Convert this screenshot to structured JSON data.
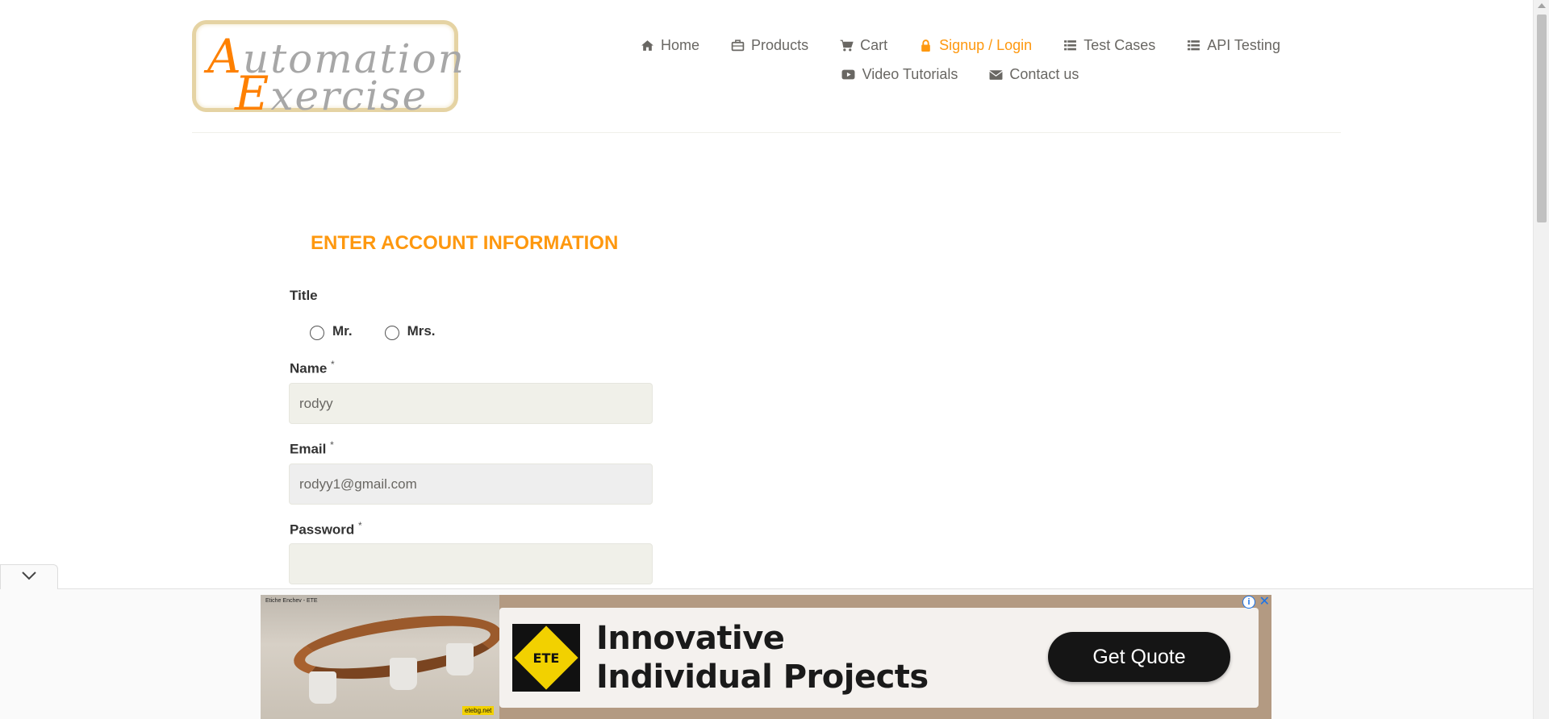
{
  "logo": {
    "line1_cap": "A",
    "line1_rest": "utomation",
    "line2_cap": "E",
    "line2_rest": "xercise"
  },
  "nav": {
    "row1": [
      {
        "label": "Home",
        "icon": "home-icon"
      },
      {
        "label": "Products",
        "icon": "briefcase-icon"
      },
      {
        "label": "Cart",
        "icon": "cart-icon"
      },
      {
        "label": "Signup / Login",
        "icon": "lock-icon",
        "active": true
      },
      {
        "label": "Test Cases",
        "icon": "list-icon"
      },
      {
        "label": "API Testing",
        "icon": "list-icon"
      }
    ],
    "row2": [
      {
        "label": "Video Tutorials",
        "icon": "youtube-play-icon"
      },
      {
        "label": "Contact us",
        "icon": "envelope-icon"
      }
    ]
  },
  "form": {
    "title": "ENTER ACCOUNT INFORMATION",
    "title_label": "Title",
    "options": [
      "Mr.",
      "Mrs."
    ],
    "name_label": "Name",
    "name_value": "rodyy",
    "email_label": "Email",
    "email_value": "rodyy1@gmail.com",
    "password_label": "Password",
    "password_value": "",
    "required_mark": "*"
  },
  "ad": {
    "headline": "Innovative Individual Projects",
    "cta": "Get Quote",
    "logo_text": "ETE",
    "top_caption": "Etiche Enchev - ETE",
    "badge": "etebg.net",
    "info_glyph": "i",
    "close_glyph": "✕"
  },
  "colors": {
    "accent": "#fe980f",
    "text": "#696763",
    "field_bg": "#f0f0e9"
  }
}
